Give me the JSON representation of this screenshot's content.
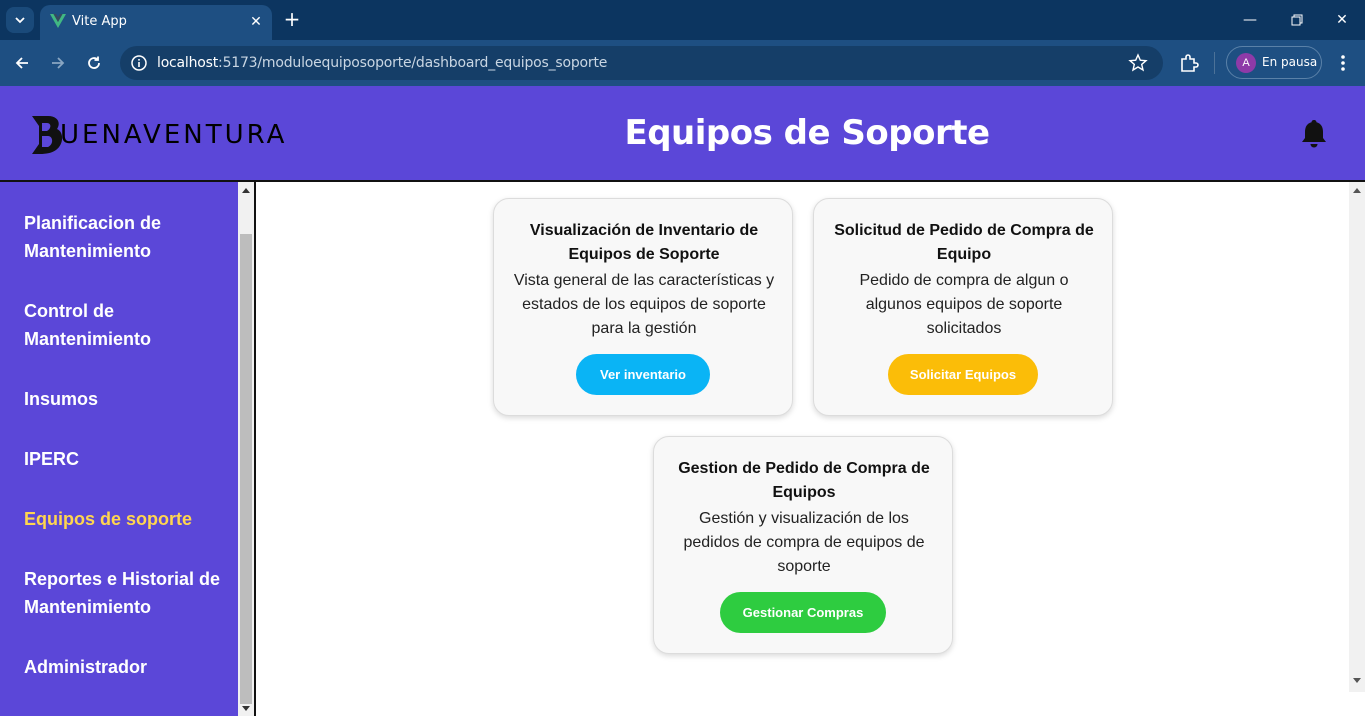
{
  "browser": {
    "tab_title": "Vite App",
    "url_host": "localhost",
    "url_rest": ":5173/moduloequiposoporte/dashboard_equipos_soporte",
    "profile_initial": "A",
    "profile_label": "En pausa"
  },
  "header": {
    "logo_text": "BUENAVENTURA",
    "title": "Equipos de Soporte"
  },
  "sidebar": {
    "items": [
      {
        "label": "Planificacion de Mantenimiento"
      },
      {
        "label": "Control de Mantenimiento"
      },
      {
        "label": "Insumos"
      },
      {
        "label": "IPERC"
      },
      {
        "label": "Equipos de soporte"
      },
      {
        "label": "Reportes e Historial de Mantenimiento"
      },
      {
        "label": "Administrador"
      }
    ]
  },
  "cards": [
    {
      "title": "Visualización de Inventario de Equipos de Soporte",
      "description": "Vista general de las características y estados de los equipos de soporte para la gestión",
      "button": "Ver inventario",
      "button_color": "#0ab4f5"
    },
    {
      "title": "Solicitud de Pedido de Compra de Equipo",
      "description": "Pedido de compra de algun o algunos equipos de soporte solicitados",
      "button": "Solicitar Equipos",
      "button_color": "#fbbd08"
    },
    {
      "title": "Gestion de Pedido de Compra de Equipos",
      "description": "Gestión y visualización de los pedidos de compra de equipos de soporte",
      "button": "Gestionar Compras",
      "button_color": "#2ecc40"
    }
  ],
  "colors": {
    "header_bg": "#5b47d8",
    "active_item": "#ffd54f",
    "browser_frame": "#0c3560"
  }
}
